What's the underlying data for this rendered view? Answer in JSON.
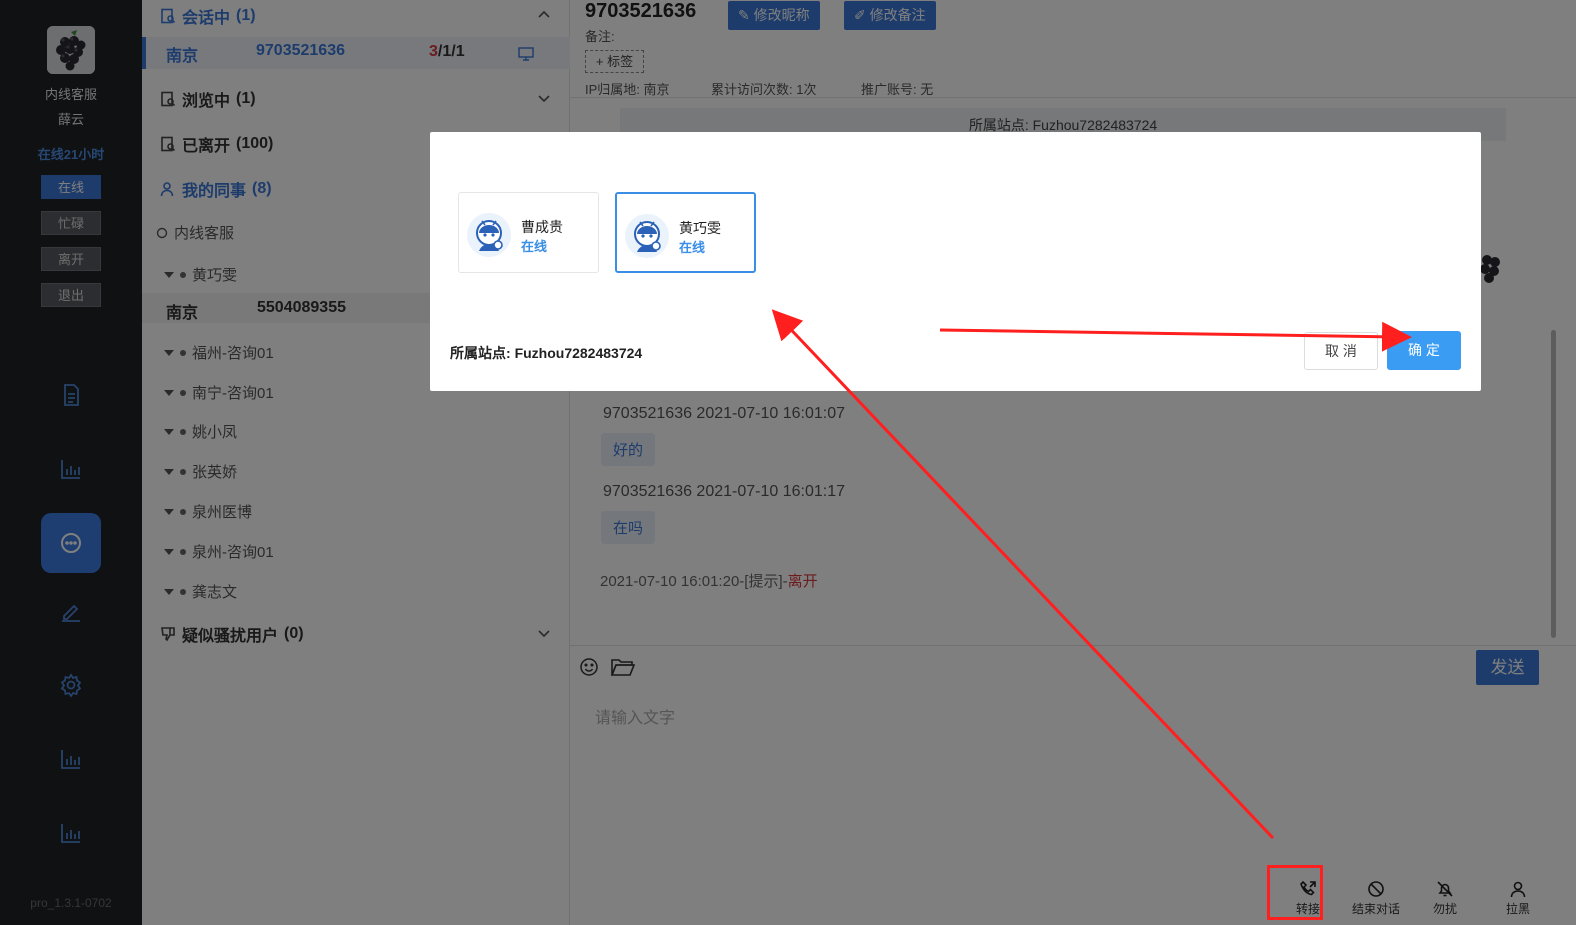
{
  "sidebar": {
    "role_label": "内线客服",
    "user_name": "薛云",
    "online_time": "在线21小时",
    "status_buttons": [
      "在线",
      "忙碌",
      "离开",
      "退出"
    ],
    "version": "pro_1.3.1-0702"
  },
  "session_list": {
    "in_session": {
      "label": "会话中",
      "count": "(1)"
    },
    "active_session": {
      "city": "南京",
      "visitor_id": "9703521636",
      "counter_red": "3",
      "counter_rest": "/1/1"
    },
    "browsing": {
      "label": "浏览中",
      "count": "(1)"
    },
    "left": {
      "label": "已离开",
      "count": "(100)"
    },
    "colleagues": {
      "label": "我的同事",
      "count": "(8)"
    },
    "subgroup": "内线客服",
    "colleague_items": [
      "黄巧雯",
      "福州-咨询01",
      "南宁-咨询01",
      "姚小凤",
      "张英娇",
      "泉州医博",
      "泉州-咨询01",
      "龚志文"
    ],
    "colleague_session": {
      "city": "南京",
      "visitor_id": "5504089355"
    },
    "suspicious": {
      "label": "疑似骚扰用户",
      "count": "(0)"
    }
  },
  "chat": {
    "visitor_id": "9703521636",
    "edit_nickname": "修改昵称",
    "edit_remark": "修改备注",
    "remark_label": "备注:",
    "tag_button": "+ 标签",
    "ip_location": "IP归属地: 南京",
    "visit_count": "累计访问次数: 1次",
    "promo_account": "推广账号: 无",
    "site_strip": "所属站点: Fuzhou7282483724",
    "messages": [
      {
        "meta": "9703521636    2021-07-10 16:01:07",
        "text": "好的"
      },
      {
        "meta": "9703521636    2021-07-10 16:01:17",
        "text": "在吗"
      }
    ],
    "system_line_prefix": "2021-07-10 16:01:20-[提示]-",
    "system_line_status": "离开",
    "input_placeholder": "请输入文字",
    "send_button": "发送",
    "actions": [
      "转接",
      "结束对话",
      "勿扰",
      "拉黑"
    ]
  },
  "modal": {
    "agents": [
      {
        "name": "曹成贵",
        "status": "在线",
        "selected": false
      },
      {
        "name": "黄巧雯",
        "status": "在线",
        "selected": true
      }
    ],
    "site_label": "所属站点:",
    "site_value": "Fuzhou7282483724",
    "cancel": "取 消",
    "confirm": "确 定"
  },
  "colors": {
    "accent": "#3a78d8",
    "confirm": "#3a9cf3",
    "annotation": "#ff1f1f",
    "leave": "#d9363e"
  }
}
